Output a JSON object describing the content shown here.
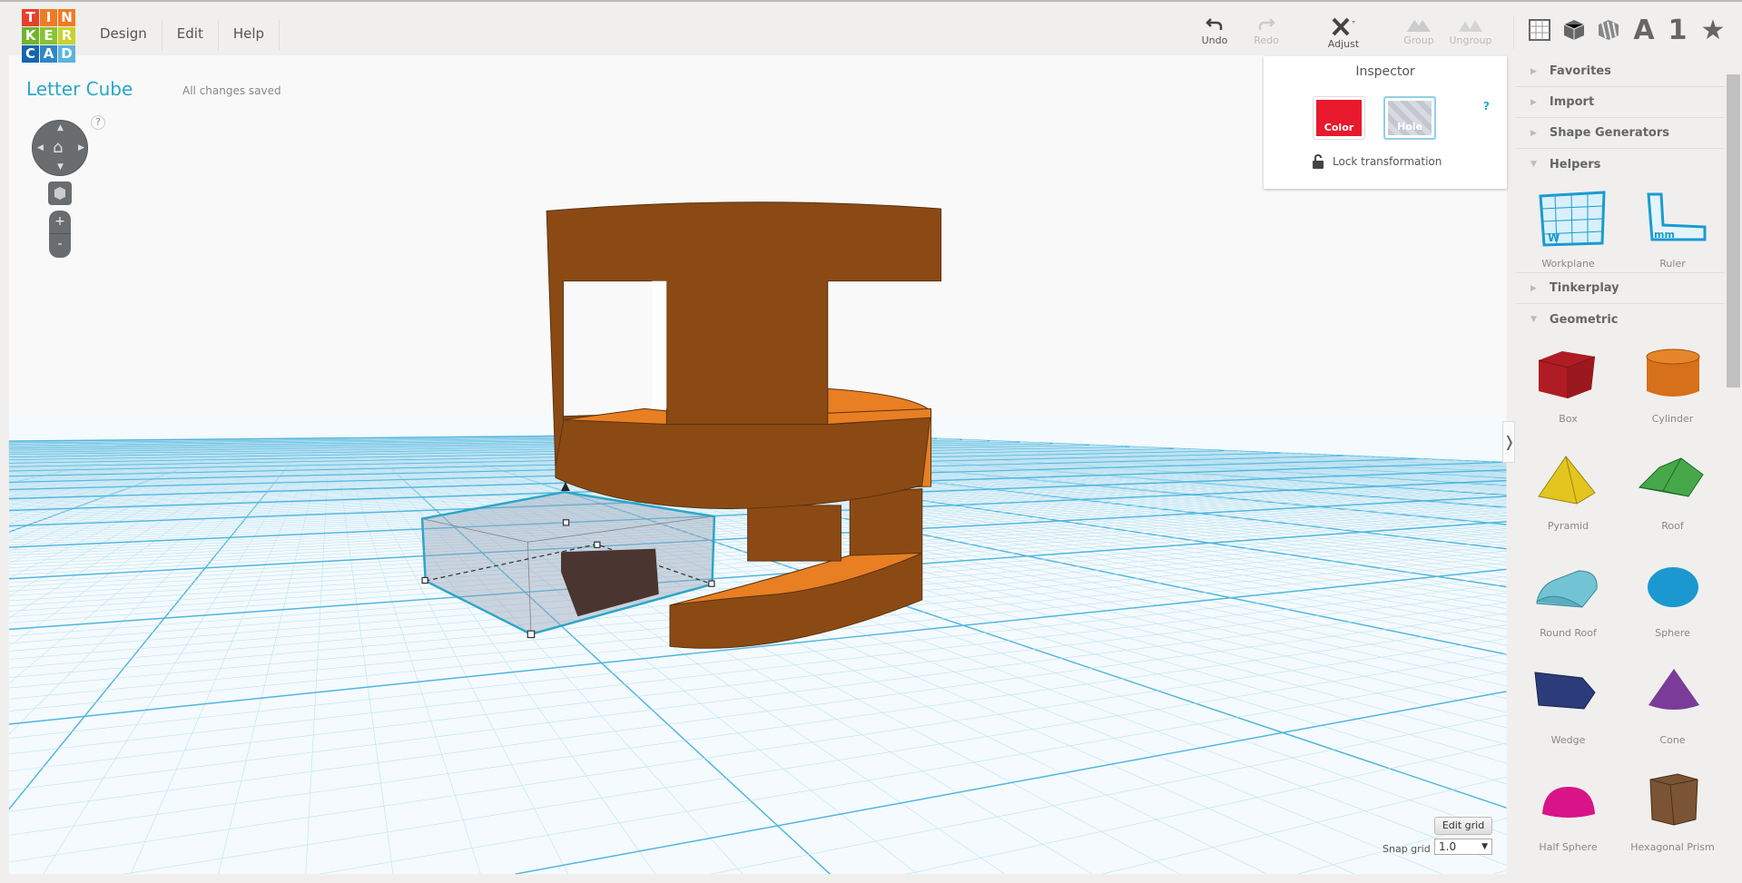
{
  "logo": {
    "letters": [
      "T",
      "I",
      "N",
      "K",
      "E",
      "R",
      "C",
      "A",
      "D"
    ],
    "colors": [
      "#e8412b",
      "#f07b25",
      "#f07b25",
      "#6fb52c",
      "#8bc233",
      "#c8d22c",
      "#1565b0",
      "#2f86c7",
      "#5ab4e0"
    ]
  },
  "menu": [
    "Design",
    "Edit",
    "Help"
  ],
  "toolbar": {
    "undo": "Undo",
    "redo": "Redo",
    "adjust": "Adjust",
    "group": "Group",
    "ungroup": "Ungroup"
  },
  "view_icons": [
    "grid-view-icon",
    "box-view-icon",
    "hole-view-icon",
    "text-icon",
    "number-icon",
    "star-icon"
  ],
  "view_text": {
    "letter": "A",
    "number": "1",
    "star": "★"
  },
  "project": {
    "title": "Letter Cube",
    "status": "All changes saved"
  },
  "viewcontrols": {
    "help": "?",
    "zoom_in": "+",
    "zoom_out": "-"
  },
  "inspector": {
    "title": "Inspector",
    "color_label": "Color",
    "hole_label": "Hole",
    "help": "?",
    "lock_label": "Lock transformation",
    "color_hex": "#e8192c"
  },
  "sidebar": {
    "sections": [
      "Favorites",
      "Import",
      "Shape Generators",
      "Helpers",
      "Tinkerplay",
      "Geometric"
    ],
    "helpers": [
      "Workplane",
      "Ruler"
    ],
    "geometric": [
      "Box",
      "Cylinder",
      "Pyramid",
      "Roof",
      "Round Roof",
      "Sphere",
      "Wedge",
      "Cone",
      "Half Sphere",
      "Hexagonal Prism"
    ]
  },
  "grid": {
    "edit_label": "Edit grid",
    "snap_label": "Snap grid",
    "snap_value": "1.0"
  },
  "colors": {
    "accent": "#2aa6c8",
    "shape": "#8b4a14",
    "shape_top": "#e87f22",
    "grid": "#7fcbe8"
  }
}
